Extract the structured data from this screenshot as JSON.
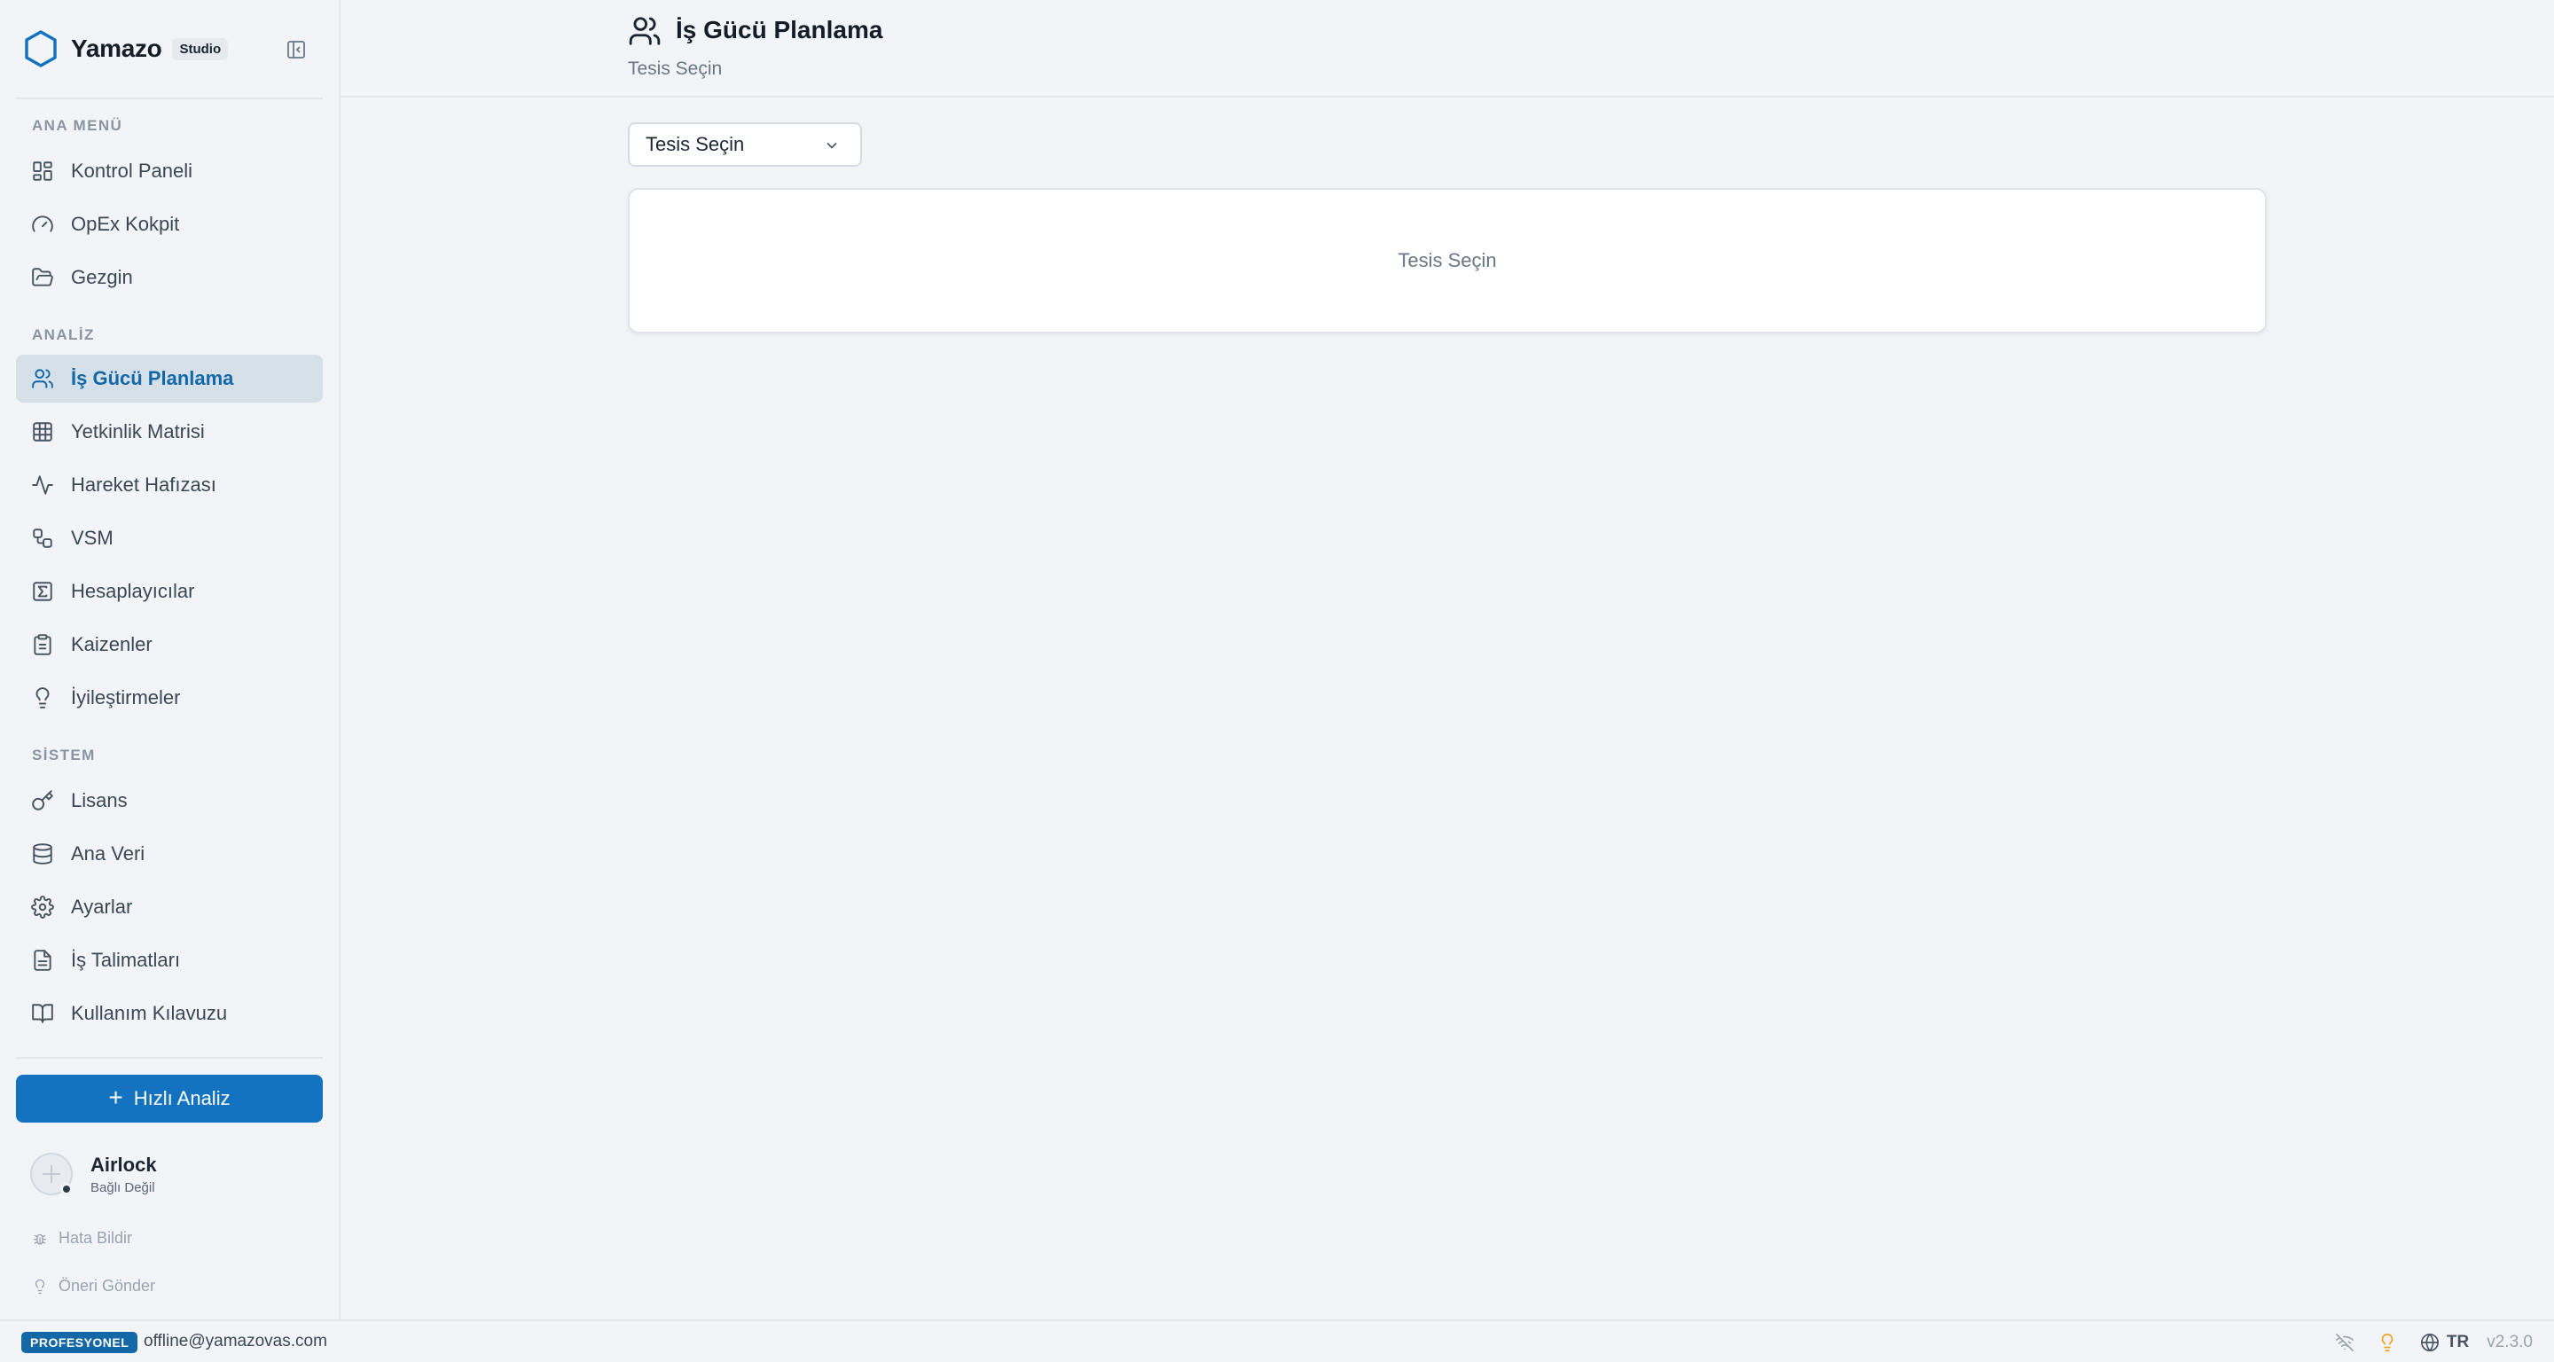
{
  "brand": {
    "name": "Yamazo",
    "badge": "Studio"
  },
  "sidebar": {
    "sections": [
      {
        "label": "ANA MENÜ"
      },
      {
        "label": "ANALİZ"
      },
      {
        "label": "SİSTEM"
      }
    ],
    "items": [
      {
        "label": "Kontrol Paneli",
        "icon": "dashboard-icon"
      },
      {
        "label": "OpEx Kokpit",
        "icon": "gauge-icon"
      },
      {
        "label": "Gezgin",
        "icon": "folder-icon"
      },
      {
        "label": "İş Gücü Planlama",
        "icon": "users-icon",
        "active": true
      },
      {
        "label": "Yetkinlik Matrisi",
        "icon": "grid-icon"
      },
      {
        "label": "Hareket Hafızası",
        "icon": "activity-icon"
      },
      {
        "label": "VSM",
        "icon": "workflow-icon"
      },
      {
        "label": "Hesaplayıcılar",
        "icon": "sigma-icon"
      },
      {
        "label": "Kaizenler",
        "icon": "clipboard-icon"
      },
      {
        "label": "İyileştirmeler",
        "icon": "lightbulb-icon"
      },
      {
        "label": "Lisans",
        "icon": "key-icon"
      },
      {
        "label": "Ana Veri",
        "icon": "database-icon"
      },
      {
        "label": "Ayarlar",
        "icon": "gear-icon"
      },
      {
        "label": "İş Talimatları",
        "icon": "document-icon"
      },
      {
        "label": "Kullanım Kılavuzu",
        "icon": "book-icon"
      }
    ],
    "quick_action": "Hızlı Analiz",
    "airlock": {
      "title": "Airlock",
      "status": "Bağlı Değil"
    },
    "report_bug": "Hata Bildir",
    "send_suggestion": "Öneri Gönder"
  },
  "header": {
    "title": "İş Gücü Planlama",
    "subtitle": "Tesis Seçin"
  },
  "main": {
    "facility_select": {
      "value": "Tesis Seçin"
    },
    "card_placeholder": "Tesis Seçin"
  },
  "statusbar": {
    "plan": "PROFESYONEL",
    "email": "offline@yamazovas.com",
    "language": "TR",
    "version": "v2.3.0"
  },
  "colors": {
    "accent": "#1473c1",
    "active_bg": "#d6e0e9",
    "tip_icon": "#f0a020"
  }
}
